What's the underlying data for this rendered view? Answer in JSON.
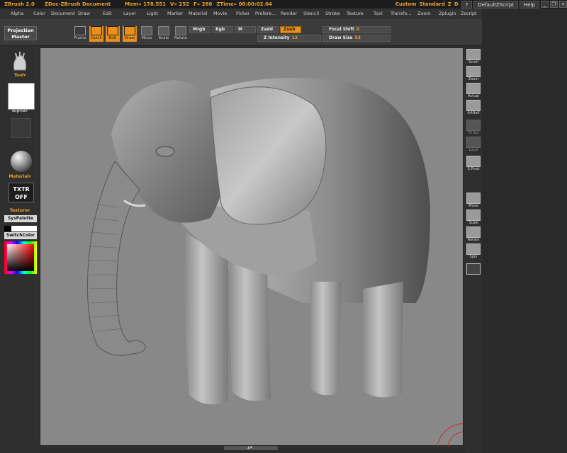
{
  "titlebar": {
    "app": "ZBrush 2.0",
    "doc": "ZDoc-ZBrush Document",
    "mem": "Mem» 178.551",
    "v": "V» 252",
    "f": "F» 266",
    "ztime": "ZTime» 00:00:02.04",
    "custom": "Custom",
    "standard": "Standard",
    "z": "Z",
    "d": "D",
    "help_q": "?",
    "default_script": "DefaultZScript",
    "help": "Help"
  },
  "menu": [
    "Alpha",
    "Color",
    "Document",
    "Draw",
    "Edit",
    "Layer",
    "Light",
    "Marker",
    "Material",
    "Movie",
    "Picker",
    "Prefere...",
    "Render",
    "Stencil",
    "Stroke",
    "Texture",
    "Tool",
    "Transfo...",
    "Zoom",
    "Zplugin",
    "Zscript"
  ],
  "toolbar": {
    "projection_master_line1": "Projection",
    "projection_master_line2": "Master",
    "frame": "Frame",
    "quick": "Quick",
    "edit": "Edit",
    "draw": "Draw",
    "move": "Move",
    "scale": "Scale",
    "rotate": "Rotate",
    "mrgb": "Mrgb",
    "rgb": "Rgb",
    "m": "M",
    "zadd": "Zadd",
    "zsub": "Zsub",
    "z_intensity_label": "Z Intensity",
    "z_intensity_value": "12",
    "focal_shift_label": "Focal Shift",
    "focal_shift_value": "0",
    "draw_size_label": "Draw Size",
    "draw_size_value": "53"
  },
  "leftpanel": {
    "tool": "Tool▾",
    "alpha": "Alpha▾",
    "material": "Material▾",
    "txtr_line1": "TXTR",
    "txtr_line2": "OFF",
    "texture": "Texture▾",
    "syspalette": "SysPalette",
    "switchcolor": "SwitchColor"
  },
  "rightpanel": {
    "scroll": "Scroll",
    "zoom": "Zoom",
    "actual": "Actual",
    "aahalf": "AAHalf",
    "ptsel": "Pt Sel",
    "local": "Local",
    "spivot": "S.Pivot",
    "move": "Move",
    "scale": "Scale",
    "rotate": "Rotate",
    "spin": "Spin"
  },
  "colors": {
    "accent": "#e8901c",
    "canvas_bg": "#888888",
    "panel_bg": "#2f2f2f"
  }
}
